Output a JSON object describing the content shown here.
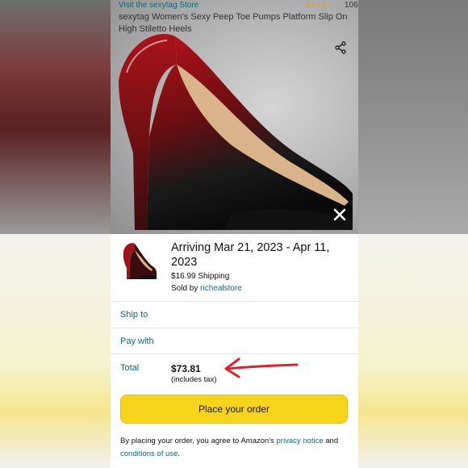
{
  "header": {
    "store_link": "Visit the sexytag Store",
    "rating_stars": "★★★★☆",
    "review_count": "106",
    "product_title": "sexytag Women's Sexy Peep Toe Pumps Platform Slip On High Stiletto Heels"
  },
  "order": {
    "arriving": "Arriving Mar 21, 2023 - Apr 11, 2023",
    "shipping": "$16.99 Shipping",
    "sold_by_prefix": "Sold by",
    "seller": "richealstore",
    "ship_to_label": "Ship to",
    "pay_with_label": "Pay with",
    "total_label": "Total",
    "total_value": "$73.81",
    "total_note": "(includes tax)",
    "place_order_label": "Place your order"
  },
  "legal": {
    "prefix": "By placing your order, you agree to Amazon's",
    "privacy_link": "privacy notice",
    "and": "and",
    "conditions_link": "conditions of use",
    "suffix": "."
  },
  "colors": {
    "accent_link": "#0f6a77",
    "button_yellow": "#f7d41c",
    "annotation_red": "#e3202a",
    "star_orange": "#e7a123"
  },
  "icons": [
    "share-icon",
    "close-icon",
    "red-arrow-annotation"
  ]
}
